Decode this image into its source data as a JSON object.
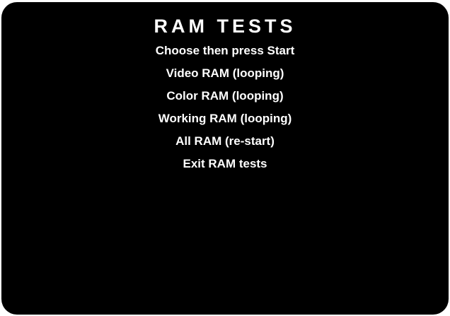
{
  "screen": {
    "title": "RAM TESTS",
    "instruction": "Choose then press Start",
    "menu_items": [
      "Video RAM (looping)",
      "Color RAM (looping)",
      "Working RAM (looping)",
      "All RAM (re-start)",
      "Exit RAM tests"
    ]
  }
}
